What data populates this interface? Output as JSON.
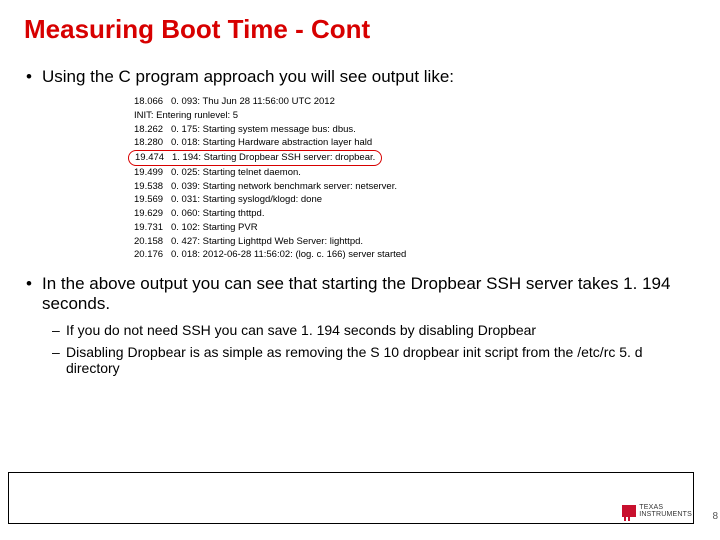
{
  "title": "Measuring Boot Time - Cont",
  "intro_bullet": "Using the C program approach you will see output like:",
  "output_lines": [
    {
      "t1": "18.066",
      "t2": "0. 093:",
      "msg": "Thu Jun 28 11:56:00 UTC 2012",
      "hl": false
    },
    {
      "t1": "",
      "t2": "",
      "msg": "INIT: Entering runlevel: 5",
      "hl": false
    },
    {
      "t1": "18.262",
      "t2": "0. 175:",
      "msg": "Starting system message bus: dbus.",
      "hl": false
    },
    {
      "t1": "18.280",
      "t2": "0. 018:",
      "msg": "Starting Hardware abstraction layer hald",
      "hl": false
    },
    {
      "t1": "19.474",
      "t2": "1. 194:",
      "msg": "Starting Dropbear SSH server: dropbear.",
      "hl": true
    },
    {
      "t1": "19.499",
      "t2": "0. 025:",
      "msg": "Starting telnet daemon.",
      "hl": false
    },
    {
      "t1": "19.538",
      "t2": "0. 039:",
      "msg": "Starting network benchmark server: netserver.",
      "hl": false
    },
    {
      "t1": "19.569",
      "t2": "0. 031:",
      "msg": "Starting syslogd/klogd: done",
      "hl": false
    },
    {
      "t1": "19.629",
      "t2": "0. 060:",
      "msg": "Starting thttpd.",
      "hl": false
    },
    {
      "t1": "19.731",
      "t2": "0. 102:",
      "msg": "Starting PVR",
      "hl": false
    },
    {
      "t1": "20.158",
      "t2": "0. 427:",
      "msg": "Starting Lighttpd Web Server: lighttpd.",
      "hl": false
    },
    {
      "t1": "20.176",
      "t2": "0. 018:",
      "msg": "2012-06-28 11:56:02: (log. c. 166) server started",
      "hl": false
    }
  ],
  "summary_bullet": "In the above output you can see that starting the Dropbear SSH server takes 1. 194 seconds.",
  "sub_bullets": [
    "If you do not need SSH you can save 1. 194 seconds by disabling Dropbear",
    "Disabling Dropbear is as simple as removing the S 10 dropbear init script from the /etc/rc 5. d directory"
  ],
  "logo_text_top": "TEXAS",
  "logo_text_bottom": "INSTRUMENTS",
  "page_num_fragment": "8"
}
